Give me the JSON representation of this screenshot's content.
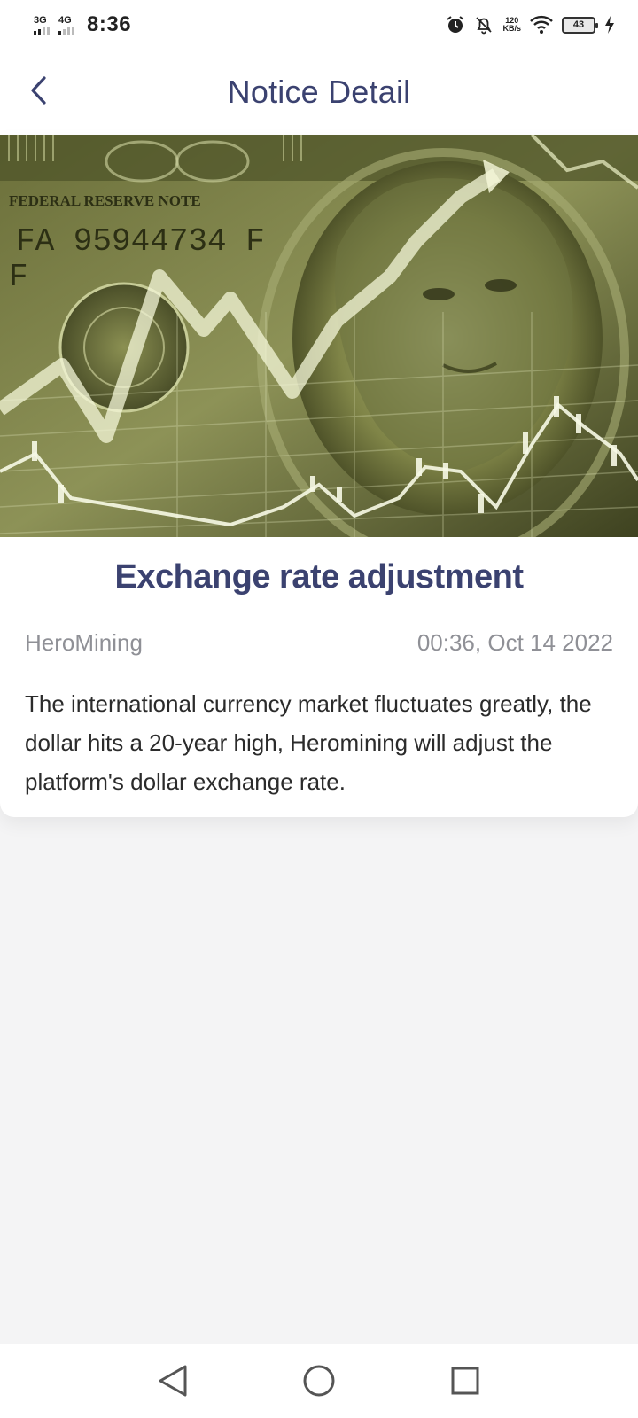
{
  "status_bar": {
    "net1": "3G",
    "net2": "4G",
    "time": "8:36",
    "speed_value": "120",
    "speed_unit": "KB/s",
    "battery": "43"
  },
  "nav": {
    "title": "Notice Detail"
  },
  "article": {
    "image_icon": "dollar-bill-stock-chart-image",
    "title": "Exchange rate adjustment",
    "author": "HeroMining",
    "timestamp": "00:36, Oct 14 2022",
    "body": "The international currency market fluctuates greatly, the dollar hits a 20-year high, Heromining will adjust the platform's dollar exchange rate.",
    "image_text": {
      "banner": "FEDERAL RESERVE NOTE",
      "serial": "FA 95944734 F",
      "serial_suffix": "F"
    }
  },
  "theme": {
    "accent": "#3b4270",
    "muted": "#8f9096",
    "background": "#f4f4f5"
  },
  "system_nav": {
    "back_icon": "triangle-back-icon",
    "home_icon": "circle-home-icon",
    "recents_icon": "square-recents-icon"
  }
}
